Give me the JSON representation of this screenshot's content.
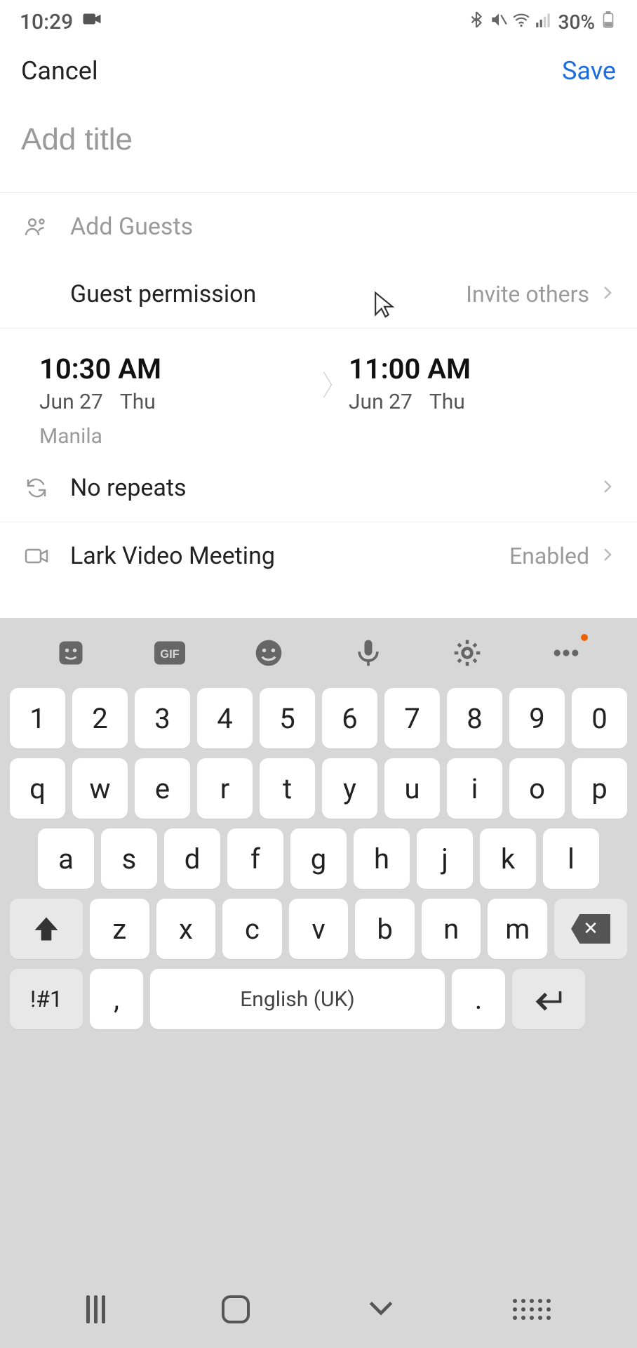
{
  "status": {
    "time": "10:29",
    "battery_percent": "30%"
  },
  "header": {
    "cancel": "Cancel",
    "save": "Save"
  },
  "title": {
    "placeholder": "Add title",
    "value": ""
  },
  "guests": {
    "add_guests": "Add Guests",
    "permission_label": "Guest permission",
    "permission_value": "Invite others"
  },
  "time": {
    "start_time": "10:30 AM",
    "start_date": "Jun 27",
    "start_day": "Thu",
    "end_time": "11:00 AM",
    "end_date": "Jun 27",
    "end_day": "Thu",
    "timezone": "Manila"
  },
  "repeats": {
    "label": "No repeats"
  },
  "video": {
    "label": "Lark Video Meeting",
    "value": "Enabled"
  },
  "keyboard": {
    "row_num": [
      "1",
      "2",
      "3",
      "4",
      "5",
      "6",
      "7",
      "8",
      "9",
      "0"
    ],
    "row_q": [
      "q",
      "w",
      "e",
      "r",
      "t",
      "y",
      "u",
      "i",
      "o",
      "p"
    ],
    "row_a": [
      "a",
      "s",
      "d",
      "f",
      "g",
      "h",
      "j",
      "k",
      "l"
    ],
    "row_z": [
      "z",
      "x",
      "c",
      "v",
      "b",
      "n",
      "m"
    ],
    "sym": "!#1",
    "comma": ",",
    "space": "English (UK)",
    "period": "."
  }
}
